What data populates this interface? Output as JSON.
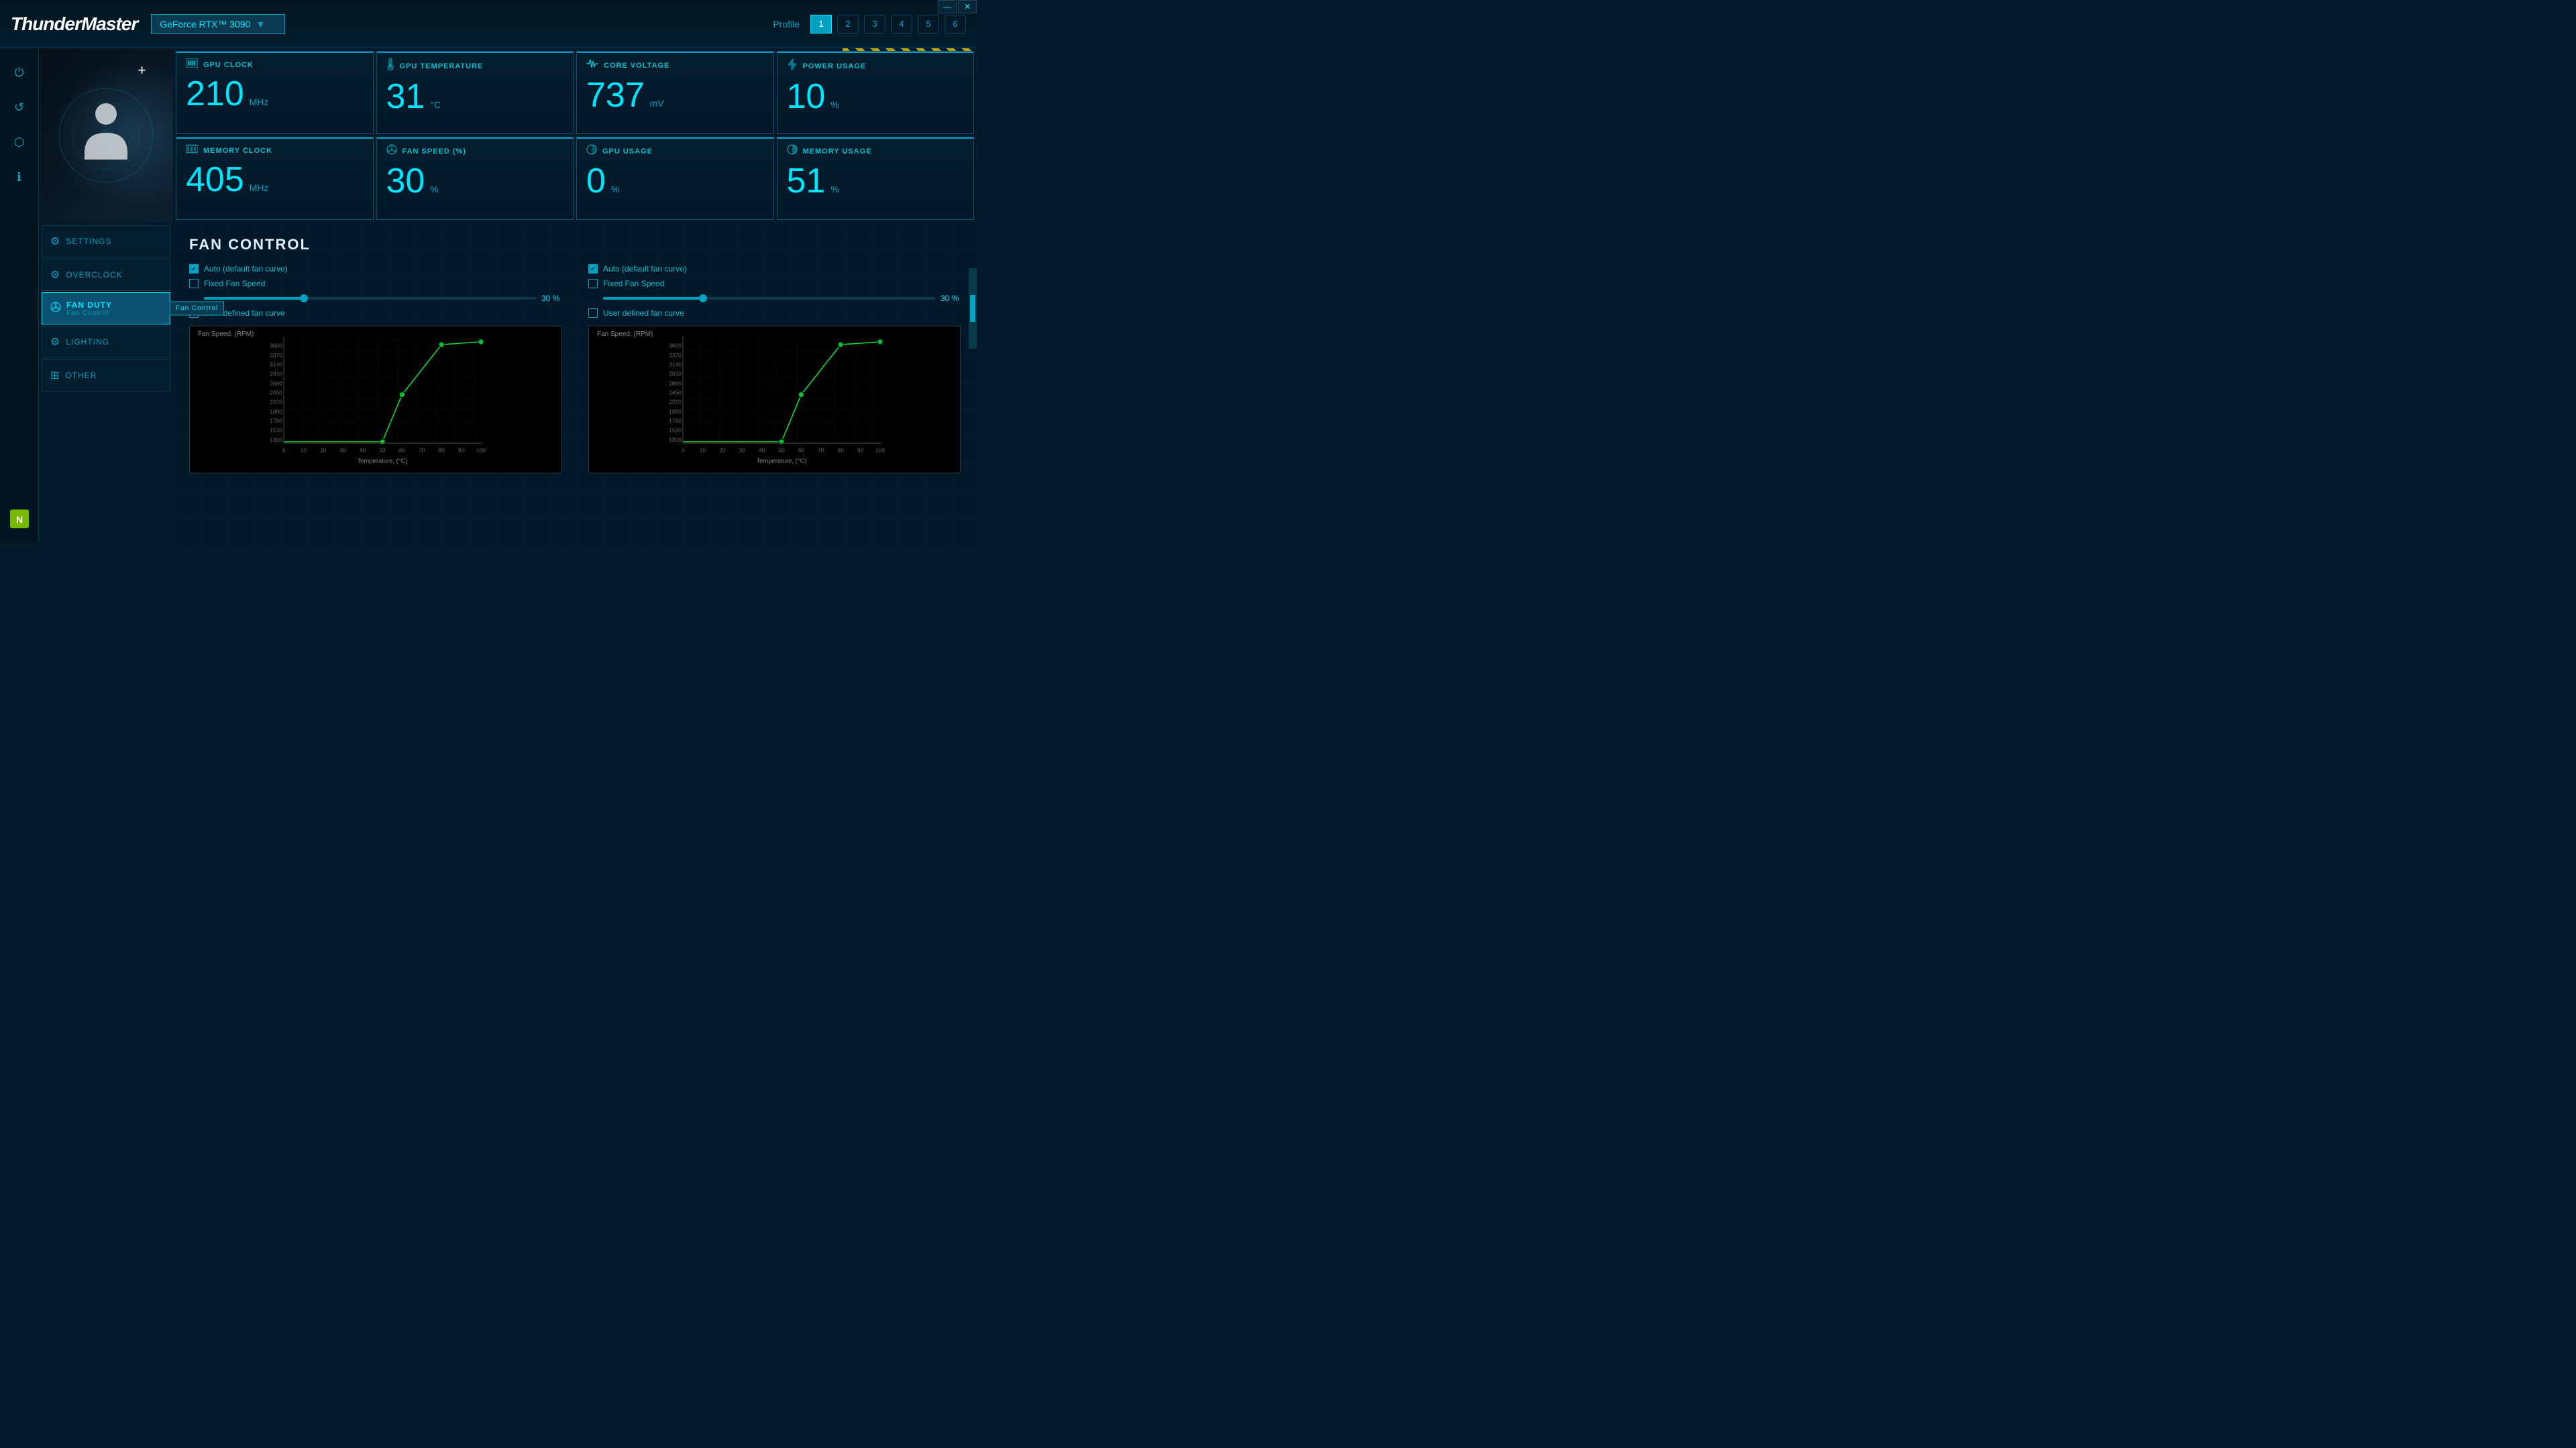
{
  "app": {
    "title": "ThunderMaster",
    "title_part1": "Thunder",
    "title_part2": "Master"
  },
  "gpu": {
    "name": "GeForce RTX™ 3090"
  },
  "titlebar": {
    "minimize": "—",
    "close": "✕"
  },
  "profile": {
    "label": "Profile",
    "buttons": [
      "1",
      "2",
      "3",
      "4",
      "5",
      "6"
    ],
    "active": 0
  },
  "stats": [
    {
      "id": "gpu-clock",
      "label": "GPU CLOCK",
      "value": "210",
      "unit": "MHz",
      "icon": "⊞"
    },
    {
      "id": "gpu-temperature",
      "label": "GPU TEMPERATURE",
      "value": "31",
      "unit": "°C",
      "icon": "🌡"
    },
    {
      "id": "core-voltage",
      "label": "CORE VOLTAGE",
      "value": "737",
      "unit": "mV",
      "icon": "⚡"
    },
    {
      "id": "power-usage",
      "label": "POWER USAGE",
      "value": "10",
      "unit": "%",
      "icon": "🔋"
    },
    {
      "id": "memory-clock",
      "label": "MEMORY CLOCK",
      "value": "405",
      "unit": "MHz",
      "icon": "▦"
    },
    {
      "id": "fan-speed",
      "label": "FAN SPEED (%)",
      "value": "30",
      "unit": "%",
      "icon": "⊕"
    },
    {
      "id": "gpu-usage",
      "label": "GPU USAGE",
      "value": "0",
      "unit": "%",
      "icon": "◔"
    },
    {
      "id": "memory-usage",
      "label": "MEMORY USAGE",
      "value": "51",
      "unit": "%",
      "icon": "◑"
    }
  ],
  "nav_tabs": [
    {
      "id": "settings",
      "label": "SETTINGS",
      "icon": "⚙"
    },
    {
      "id": "overclock",
      "label": "OVERCLOCK",
      "icon": "⚙"
    },
    {
      "id": "fan-duty",
      "label": "FAN DUTY",
      "sublabel": "Fan Control",
      "icon": "⊕",
      "active": true
    },
    {
      "id": "lighting",
      "label": "LIGHTING",
      "icon": "⚙"
    },
    {
      "id": "other",
      "label": "OTHER",
      "icon": "⊞"
    }
  ],
  "sidebar_items": [
    {
      "id": "power",
      "icon": "⏻"
    },
    {
      "id": "refresh",
      "icon": "↺"
    },
    {
      "id": "3d",
      "icon": "⬡"
    },
    {
      "id": "info",
      "icon": "ℹ"
    },
    {
      "id": "nvidia",
      "icon": "N"
    }
  ],
  "fan_control": {
    "title": "FAN CONTROL",
    "fan1": {
      "auto_label": "Auto (default fan curve)",
      "fixed_label": "Fixed Fan Speed",
      "user_label": "User defined fan curve",
      "fixed_value": "30",
      "fixed_unit": "%",
      "auto_checked": true,
      "fixed_checked": false,
      "user_checked": false
    },
    "fan2": {
      "auto_label": "Auto (default fan curve)",
      "fixed_label": "Fixed Fan Speed",
      "user_label": "User defined fan curve",
      "fixed_value": "30",
      "fixed_unit": "%",
      "auto_checked": true,
      "fixed_checked": false,
      "user_checked": false
    },
    "chart": {
      "y_label": "Fan Speed. (RPM)",
      "x_label": "Temperature, (°C)",
      "y_ticks": [
        "1300",
        "1530",
        "1760",
        "1990",
        "2220",
        "2450",
        "2680",
        "2910",
        "3140",
        "3370",
        "3600"
      ],
      "x_ticks": [
        "0",
        "10",
        "20",
        "30",
        "40",
        "50",
        "60",
        "70",
        "80",
        "90",
        "100"
      ]
    }
  }
}
